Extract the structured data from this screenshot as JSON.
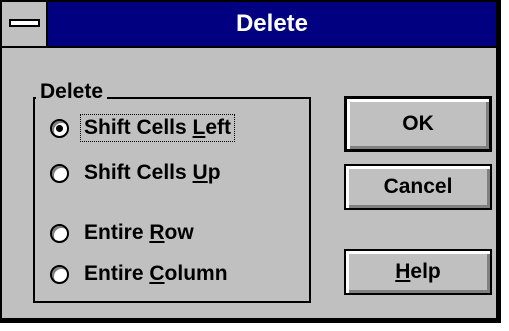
{
  "dialog": {
    "title": "Delete"
  },
  "group": {
    "legend": "Delete"
  },
  "options": [
    {
      "pre": "Shift Cells ",
      "key": "L",
      "post": "eft",
      "selected": true
    },
    {
      "pre": "Shift Cells ",
      "key": "U",
      "post": "p",
      "selected": false
    },
    {
      "pre": "Entire ",
      "key": "R",
      "post": "ow",
      "selected": false
    },
    {
      "pre": "Entire ",
      "key": "C",
      "post": "olumn",
      "selected": false
    }
  ],
  "buttons": {
    "ok": "OK",
    "cancel": "Cancel",
    "help": {
      "pre": "",
      "key": "H",
      "post": "elp"
    }
  }
}
